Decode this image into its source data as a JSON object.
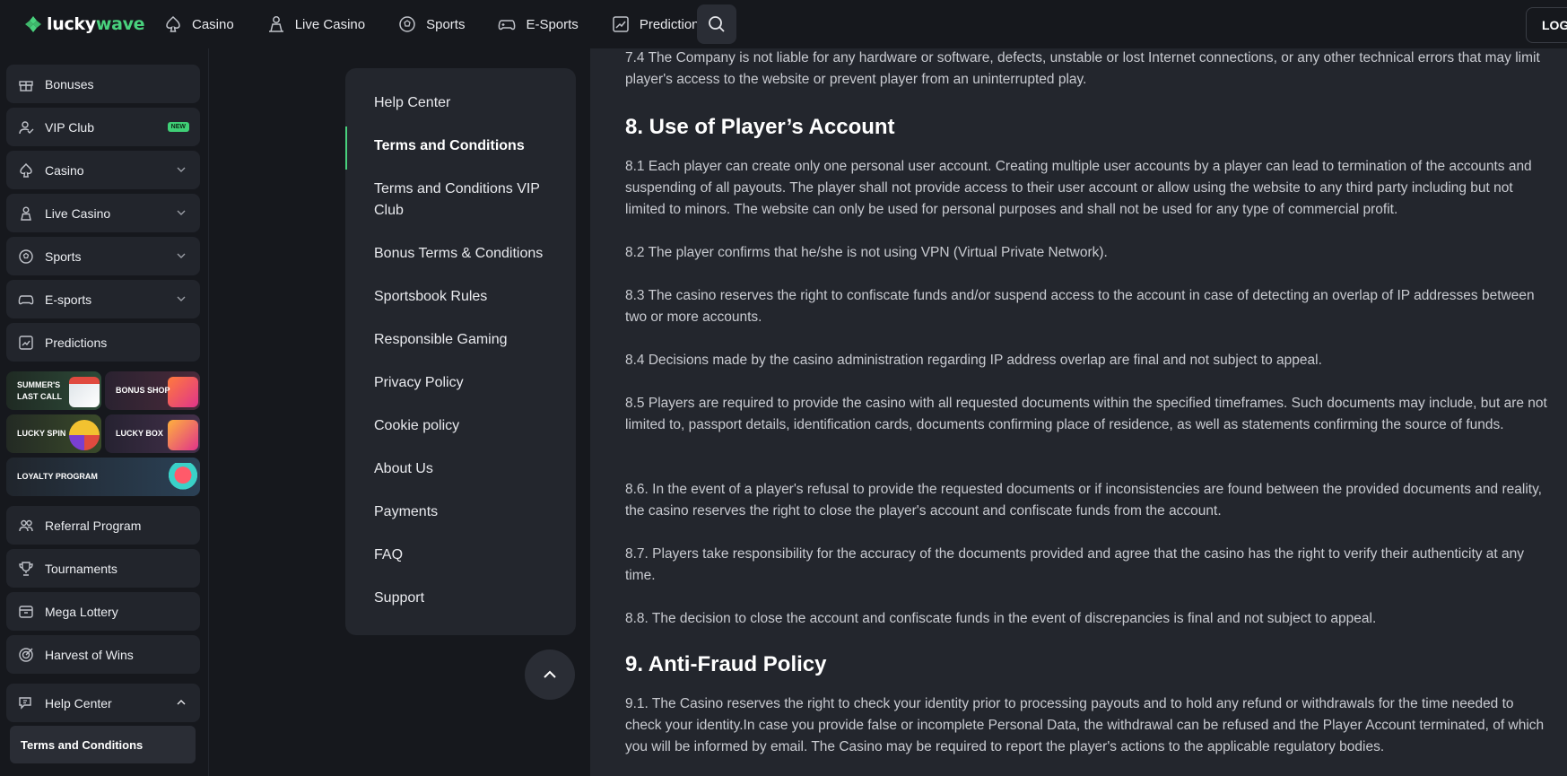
{
  "header": {
    "logo_part1": "lucky",
    "logo_part2": "wave",
    "nav": [
      {
        "label": "Casino",
        "icon": "spade-icon"
      },
      {
        "label": "Live Casino",
        "icon": "dealer-icon"
      },
      {
        "label": "Sports",
        "icon": "soccer-ball-icon"
      },
      {
        "label": "E-Sports",
        "icon": "gamepad-icon"
      },
      {
        "label": "Predictions",
        "icon": "chart-trend-icon"
      }
    ],
    "login_label": "LOG"
  },
  "sidebar": {
    "items": [
      {
        "label": "Bonuses",
        "icon": "gift-icon"
      },
      {
        "label": "VIP Club",
        "icon": "vip-user-icon",
        "badge": "NEW"
      },
      {
        "label": "Casino",
        "icon": "spade-icon"
      },
      {
        "label": "Live Casino",
        "icon": "dealer-icon"
      },
      {
        "label": "Sports",
        "icon": "soccer-ball-icon"
      },
      {
        "label": "E-sports",
        "icon": "gamepad-icon"
      },
      {
        "label": "Predictions",
        "icon": "chart-trend-icon"
      }
    ],
    "promos": {
      "summer_line1": "SUMMER'S",
      "summer_line2": "LAST CALL",
      "bonus_shop": "BONUS SHOP",
      "lucky_spin": "LUCKY SPIN",
      "lucky_box": "LUCKY BOX",
      "loyalty": "LOYALTY PROGRAM"
    },
    "items2": [
      {
        "label": "Referral Program",
        "icon": "people-icon"
      },
      {
        "label": "Tournaments",
        "icon": "trophy-icon"
      },
      {
        "label": "Mega Lottery",
        "icon": "ticket-icon"
      },
      {
        "label": "Harvest of Wins",
        "icon": "target-icon"
      }
    ],
    "help_center": {
      "label": "Help Center",
      "icon": "chat-help-icon"
    },
    "sub_item": "Terms and Conditions"
  },
  "help_menu": [
    {
      "label": "Help Center"
    },
    {
      "label": "Terms and Conditions",
      "active": true
    },
    {
      "label": "Terms and Conditions VIP Club"
    },
    {
      "label": "Bonus Terms & Conditions"
    },
    {
      "label": "Sportsbook Rules"
    },
    {
      "label": "Responsible Gaming"
    },
    {
      "label": "Privacy Policy"
    },
    {
      "label": "Cookie policy"
    },
    {
      "label": "About Us"
    },
    {
      "label": "Payments"
    },
    {
      "label": "FAQ"
    },
    {
      "label": "Support"
    }
  ],
  "content": {
    "p74": "7.4 The Company is not liable for any hardware or software, defects, unstable or lost Internet connections, or any other technical errors that may limit player's access to the website or prevent player from an uninterrupted play.",
    "h8": "8. Use of Player’s Account",
    "p81": "8.1 Each player can create only one personal user account. Creating multiple user accounts by a player can lead to termination of the accounts and suspending of all payouts. The player shall not provide access to their user account or allow using the website to any third party including but not limited to minors. The website can only be used for personal purposes and shall not be used for any type of commercial profit.",
    "p82": "8.2  The player confirms that he/she is not using VPN (Virtual Private Network).",
    "p83": "8.3 The casino reserves the right to confiscate funds and/or suspend access to the account in case of detecting an overlap of IP addresses between two or more accounts.",
    "p84": "8.4 Decisions made by the casino administration regarding IP address overlap are final and not subject to appeal.",
    "p85": "8.5 Players are required to provide the casino with all requested documents within the specified timeframes. Such documents may include, but are not limited to, passport details, identification cards, documents confirming place of residence, as well as statements confirming the source of funds.",
    "p86": "8.6. In the event of a player's refusal to provide the requested documents or if inconsistencies are found between the provided documents and reality, the casino reserves the right to close the player's account and confiscate funds from the account.",
    "p87": "8.7. Players take responsibility for the accuracy of the documents provided and agree that the casino has the right to verify their authenticity at any time.",
    "p88": "8.8. The decision to close the account and confiscate funds in the event of discrepancies is final and not subject to appeal.",
    "h9": "9. Anti-Fraud Policy",
    "p91": "9.1. The Casino reserves the right to check your identity prior to processing payouts and to hold any refund or withdrawals for the time needed to check your identity.In case you provide false or incomplete Personal Data, the withdrawal can be refused and the Player Account terminated, of which you will be informed by email. The Casino may be required to report the player's actions to the applicable regulatory bodies."
  },
  "colors": {
    "accent": "#49d17d",
    "bg": "#16181d",
    "panel": "#23262d"
  }
}
